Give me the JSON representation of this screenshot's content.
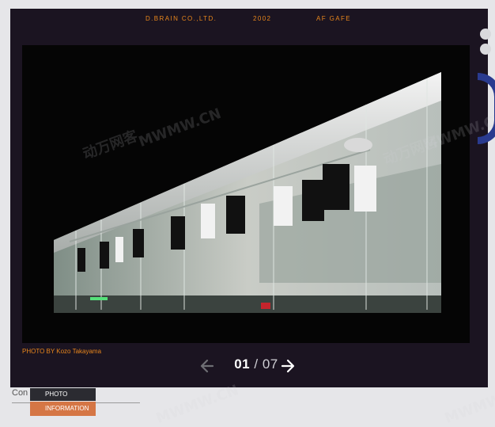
{
  "header": {
    "company": "D.BRAIN CO.,LTD.",
    "year": "2002",
    "project": "AF GAFE"
  },
  "photo": {
    "caption": "PHOTO BY Kozo Takayama",
    "watermark": "MWMW.CN",
    "watermark_cn": "动万网客"
  },
  "pagination": {
    "current": "01",
    "separator": "/",
    "total": "07",
    "prev_icon": "arrow-left-icon",
    "next_icon": "arrow-right-icon"
  },
  "footer": {
    "content_label": "Con",
    "menu": [
      {
        "label": "PHOTO"
      },
      {
        "label": "INFORMATION"
      }
    ]
  },
  "colors": {
    "accent": "#e8861c",
    "frame": "#1b1421",
    "menu_active": "#d57645",
    "menu_dark": "#2b2b31"
  }
}
